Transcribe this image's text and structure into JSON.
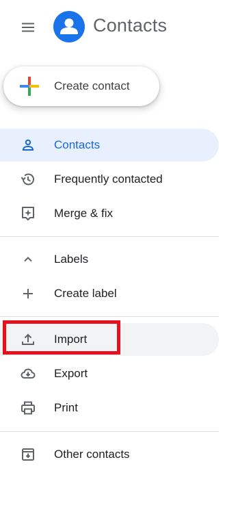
{
  "app": {
    "title": "Contacts"
  },
  "create_button": {
    "label": "Create contact"
  },
  "nav": {
    "contacts": "Contacts",
    "frequently_contacted": "Frequently contacted",
    "merge_fix": "Merge & fix",
    "labels": "Labels",
    "create_label": "Create label",
    "import": "Import",
    "export": "Export",
    "print": "Print",
    "other_contacts": "Other contacts"
  },
  "colors": {
    "accent": "#1a73e8",
    "active_bg": "#e8f0fe",
    "highlight": "#e8101e"
  },
  "icons": {
    "menu": "hamburger-menu-icon",
    "logo": "person-avatar-icon",
    "contacts": "person-icon",
    "frequent": "history-icon",
    "merge": "merge-sparkle-icon",
    "labels": "chevron-up-icon",
    "create_label": "plus-icon",
    "import": "upload-icon",
    "export": "cloud-download-icon",
    "print": "printer-icon",
    "other": "archive-down-icon"
  }
}
